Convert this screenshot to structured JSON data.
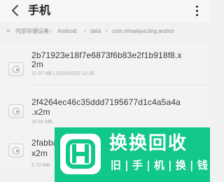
{
  "header": {
    "back_icon": "back-chevron-icon",
    "title": "手机",
    "more_icon": "more-vertical-icon"
  },
  "breadcrumb": {
    "chevron_icon": "chevron-down-icon",
    "items": [
      "内部存储设备",
      "Android",
      "data",
      "com.ximalaya.ting.androi"
    ],
    "separator": "›"
  },
  "files": [
    {
      "name_line_1": "2b71923e18f7e6873f6b83e2f1b918f8.x",
      "name_line_2": "2m",
      "meta": "11.07 MB | 2019/10/22 12:35",
      "icon": "file-icon"
    },
    {
      "name_line_1": "2f4264ec46c35ddd7195677d1c4a5a4a",
      "name_line_2": ".x2m",
      "meta": "10.55 MB",
      "icon": "file-icon"
    },
    {
      "name_line_1": "2fabba",
      "name_line_2": "x2m",
      "meta": "9.73 MB",
      "icon": "file-icon"
    }
  ],
  "watermark": {
    "brand": "换换回收",
    "subtitle": "旧 | 手 | 机 | 换 | 钱",
    "logo_icon": "huanhuan-logo-icon",
    "background_color": "#12c78b"
  }
}
